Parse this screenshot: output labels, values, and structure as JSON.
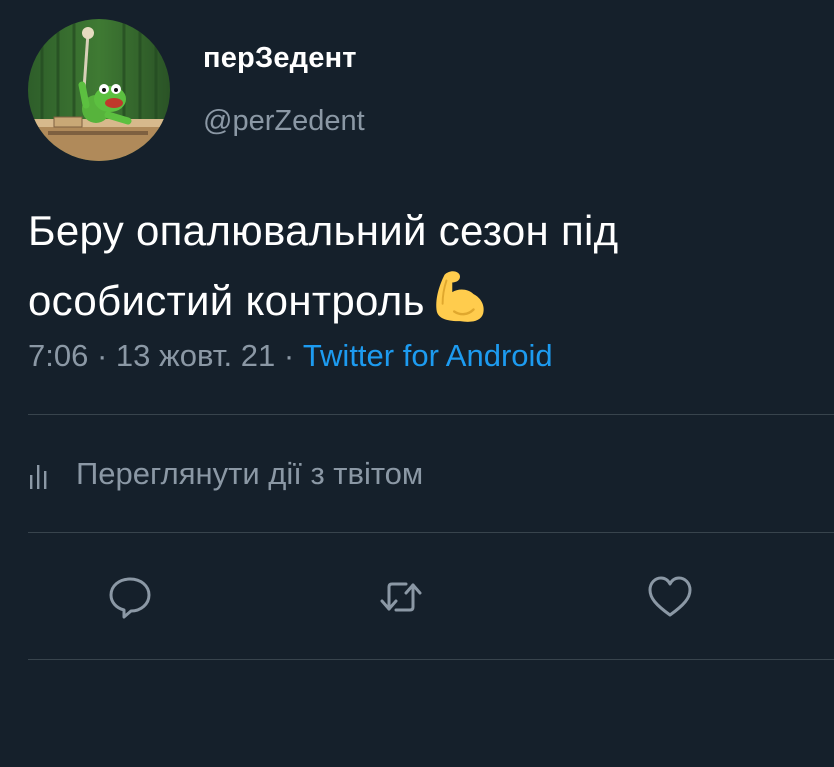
{
  "user": {
    "display_name": "перЗедент",
    "handle": "@perZedent"
  },
  "tweet": {
    "text_line1": "Беру опалювальний сезон під",
    "text_line2": "особистий контроль",
    "emoji": "flexed-biceps-icon"
  },
  "meta": {
    "time": "7:06",
    "separator1": " · ",
    "date": "13 жовт. 21",
    "separator2": " · ",
    "source": "Twitter for Android"
  },
  "analytics": {
    "label": "Переглянути дії з твітом",
    "icon": "analytics-icon"
  },
  "actions": {
    "reply_icon": "reply-icon",
    "retweet_icon": "retweet-icon",
    "like_icon": "heart-icon"
  },
  "colors": {
    "background": "#15202b",
    "secondary_text": "#8b98a5",
    "link": "#1d9bf0",
    "divider": "#38444d"
  }
}
